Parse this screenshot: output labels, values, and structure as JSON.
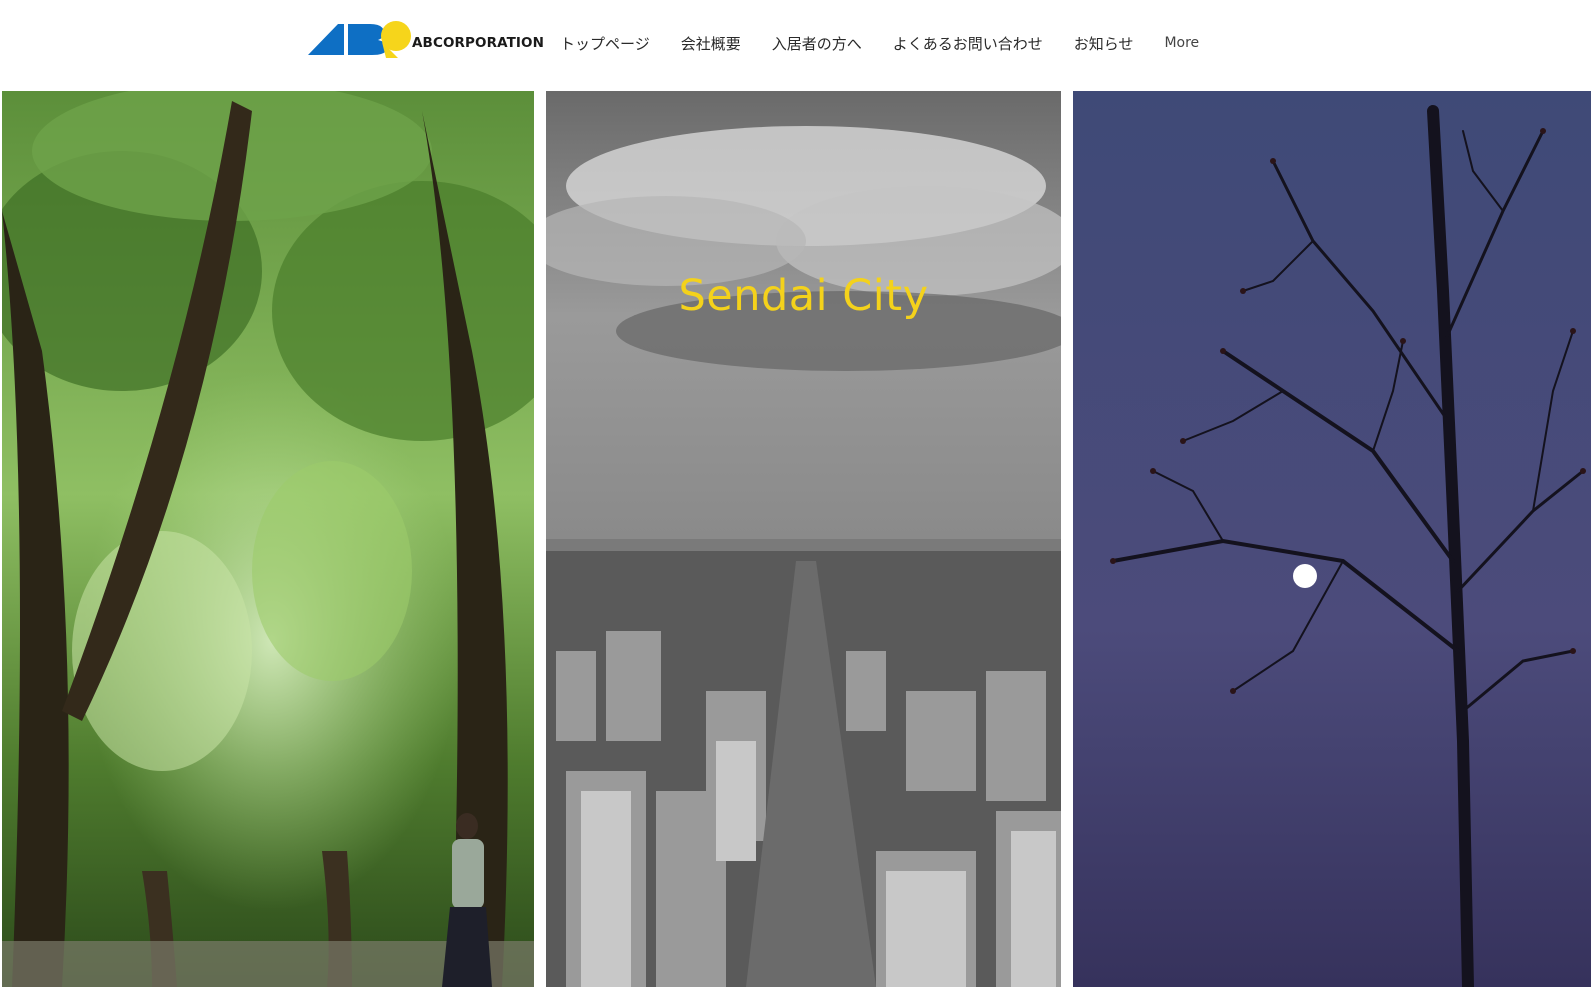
{
  "header": {
    "logo_text": "ABCORPORATION",
    "nav": [
      {
        "label": "トップページ"
      },
      {
        "label": "会社概要"
      },
      {
        "label": "入居者の方へ"
      },
      {
        "label": "よくあるお問い合わせ"
      },
      {
        "label": "お知らせ"
      },
      {
        "label": "More"
      }
    ]
  },
  "hero": {
    "title": "Sendai City"
  },
  "colors": {
    "brand_blue": "#0e6fc4",
    "brand_yellow": "#f6d51b",
    "title_yellow": "#f4d21b",
    "night_sky": "#4a4a78"
  }
}
